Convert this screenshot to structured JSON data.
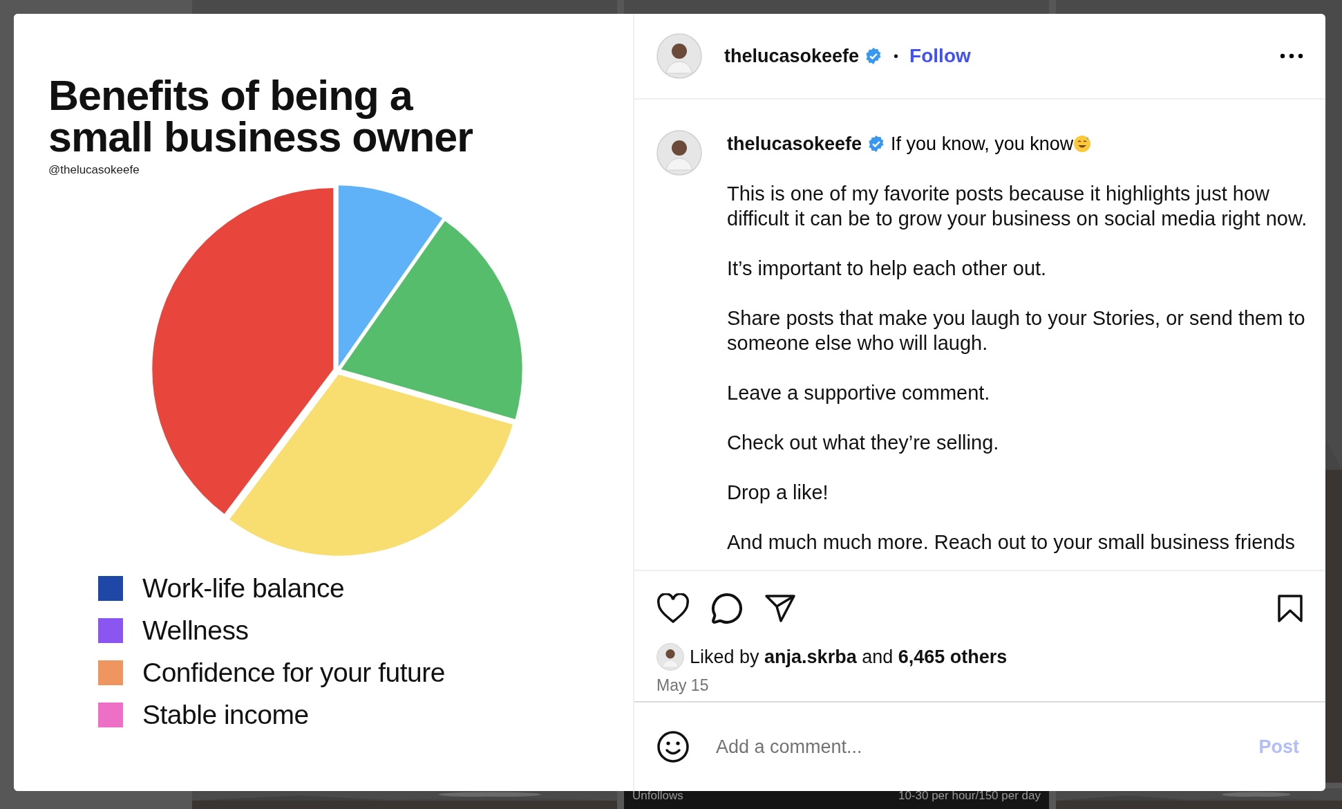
{
  "backdrop": {
    "tiles": [
      {
        "kind": "picture"
      },
      {
        "kind": "picture"
      },
      {
        "kind": "picture"
      },
      {
        "kind": "picture"
      },
      {
        "kind": "stats",
        "column_1": "Unfollows",
        "column_2": "10-30 per hour/150 per day"
      },
      {
        "kind": "picture"
      }
    ]
  },
  "post_image": {
    "title": "Benefits of being a small business owner",
    "handle": "@thelucasokeefe",
    "legend": [
      {
        "label": "Work-life balance",
        "color": "#1e47a8"
      },
      {
        "label": "Wellness",
        "color": "#8b55f2"
      },
      {
        "label": "Confidence for your future",
        "color": "#ef9660"
      },
      {
        "label": "Stable income",
        "color": "#ee6fc6"
      }
    ]
  },
  "header": {
    "username": "thelucasokeefe",
    "verified": true,
    "separator": "•",
    "follow": "Follow"
  },
  "caption": {
    "username": "thelucasokeefe",
    "verified": true,
    "headline": "If you know, you know",
    "paragraphs": [
      "This is one of my favorite posts because it highlights just how difficult it can be to grow your business on social media right now.",
      "It’s important to help each other out.",
      "Share posts that make you laugh to your Stories, or send them to someone else who will laugh.",
      "Leave a supportive comment.",
      "Check out what they’re selling.",
      "Drop a like!",
      "And much much more. Reach out to your small business friends"
    ]
  },
  "likes": {
    "text": "Liked by **anja.skrba** and **6,465 others**",
    "date": "May 15"
  },
  "comment": {
    "placeholder": "Add a comment...",
    "post": "Post"
  }
}
